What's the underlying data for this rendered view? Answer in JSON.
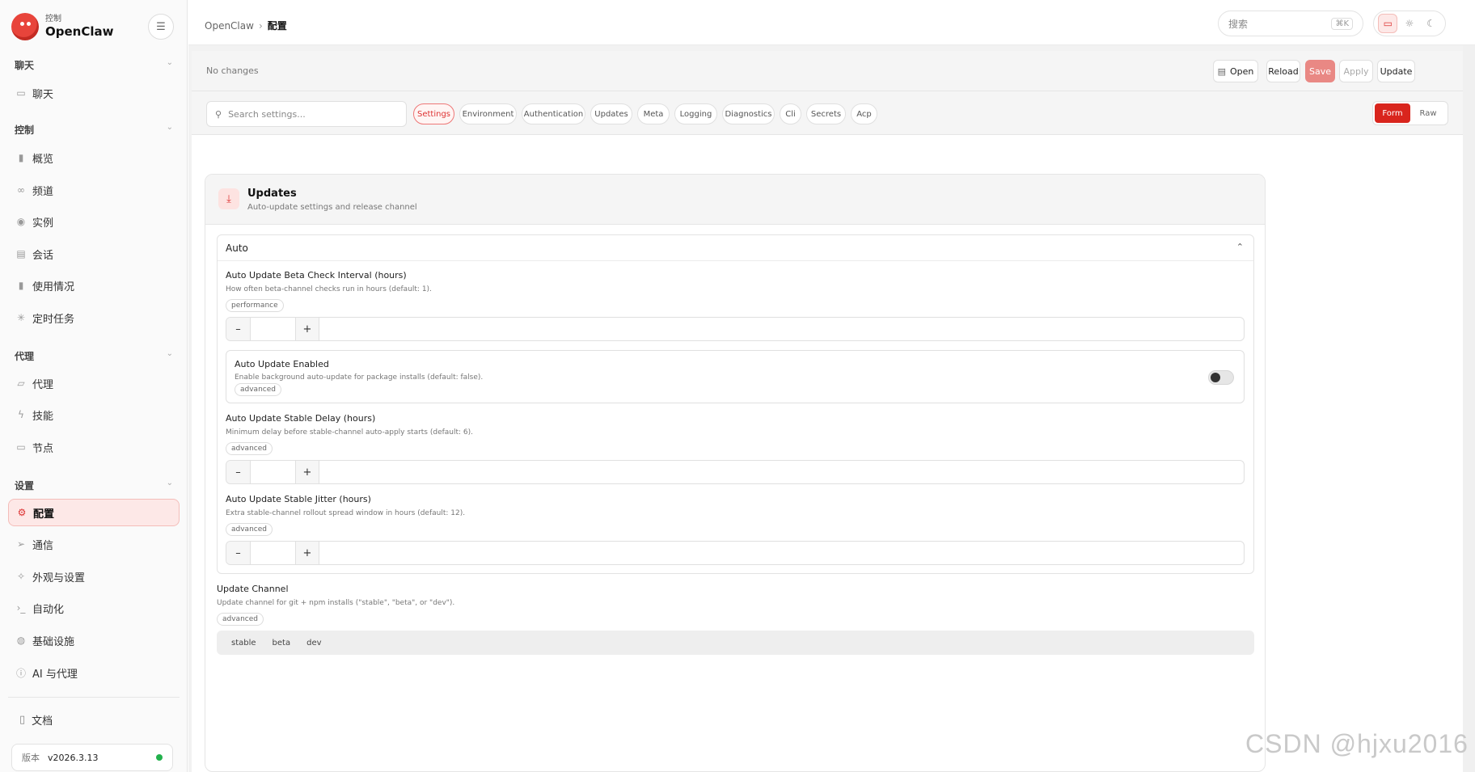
{
  "brand": {
    "sub": "控制",
    "name": "OpenClaw"
  },
  "sidebar": {
    "groups": [
      {
        "label": "聊天",
        "items": [
          {
            "label": "聊天",
            "icon": "chat-icon"
          }
        ]
      },
      {
        "label": "控制",
        "items": [
          {
            "label": "概览",
            "icon": "bar-chart-icon"
          },
          {
            "label": "频道",
            "icon": "link-icon"
          },
          {
            "label": "实例",
            "icon": "radio-icon"
          },
          {
            "label": "会话",
            "icon": "document-icon"
          },
          {
            "label": "使用情况",
            "icon": "bar-chart-icon"
          },
          {
            "label": "定时任务",
            "icon": "loader-icon"
          }
        ]
      },
      {
        "label": "代理",
        "items": [
          {
            "label": "代理",
            "icon": "folder-icon"
          },
          {
            "label": "技能",
            "icon": "bolt-icon"
          },
          {
            "label": "节点",
            "icon": "monitor-icon"
          }
        ]
      },
      {
        "label": "设置",
        "items": [
          {
            "label": "配置",
            "icon": "gear-icon",
            "active": true
          },
          {
            "label": "通信",
            "icon": "send-icon"
          },
          {
            "label": "外观与设置",
            "icon": "sparkle-icon"
          },
          {
            "label": "自动化",
            "icon": "terminal-icon"
          },
          {
            "label": "基础设施",
            "icon": "globe-icon"
          },
          {
            "label": "AI 与代理",
            "icon": "info-icon"
          }
        ]
      }
    ],
    "docs": "文档",
    "version_label": "版本",
    "version": "v2026.3.13"
  },
  "topbar": {
    "breadcrumb": [
      "OpenClaw",
      "配置"
    ],
    "search_placeholder": "搜索",
    "search_shortcut": "⌘K"
  },
  "actions": {
    "status": "No changes",
    "open": "Open",
    "reload": "Reload",
    "save": "Save",
    "apply": "Apply",
    "update": "Update"
  },
  "filters": {
    "search_placeholder": "Search settings...",
    "tabs": [
      "Settings",
      "Environment",
      "Authentication",
      "Updates",
      "Meta",
      "Logging",
      "Diagnostics",
      "Cli",
      "Secrets",
      "Acp"
    ],
    "active_tab": "Settings",
    "mode": [
      "Form",
      "Raw"
    ],
    "active_mode": "Form"
  },
  "section": {
    "title": "Updates",
    "subtitle": "Auto-update settings and release channel",
    "auto": {
      "title": "Auto",
      "fields": [
        {
          "title": "Auto Update Beta Check Interval (hours)",
          "desc": "How often beta-channel checks run in hours (default: 1).",
          "tag": "performance",
          "value": ""
        },
        {
          "title": "Auto Update Enabled",
          "desc": "Enable background auto-update for package installs (default: false).",
          "tag": "advanced",
          "enabled": false
        },
        {
          "title": "Auto Update Stable Delay (hours)",
          "desc": "Minimum delay before stable-channel auto-apply starts (default: 6).",
          "tag": "advanced",
          "value": ""
        },
        {
          "title": "Auto Update Stable Jitter (hours)",
          "desc": "Extra stable-channel rollout spread window in hours (default: 12).",
          "tag": "advanced",
          "value": ""
        }
      ]
    },
    "channel": {
      "title": "Update Channel",
      "desc": "Update channel for git + npm installs (\"stable\", \"beta\", or \"dev\").",
      "tag": "advanced",
      "options": [
        "stable",
        "beta",
        "dev"
      ]
    }
  },
  "watermark": "CSDN @hjxu2016",
  "colors": {
    "accent": "#d9251d",
    "accent_soft": "#fde8e7",
    "status_ok": "#22b14c"
  }
}
